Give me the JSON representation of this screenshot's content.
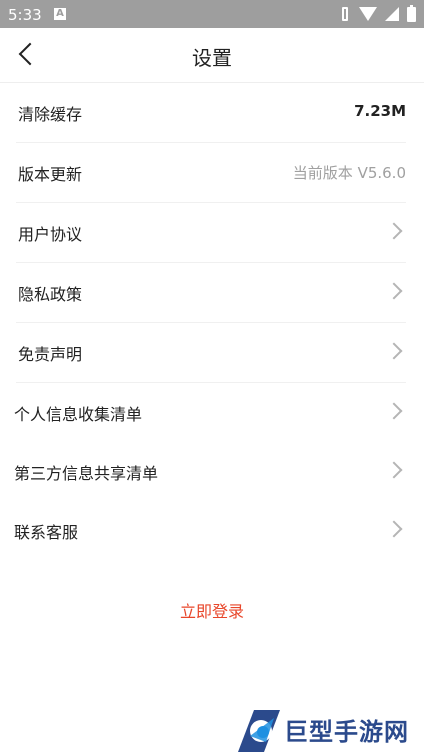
{
  "status": {
    "time": "5:33",
    "notif_letter": "A"
  },
  "header": {
    "title": "设置"
  },
  "rows": [
    {
      "label": "清除缓存",
      "value": "7.23M"
    },
    {
      "label": "版本更新",
      "value": "当前版本 V5.6.0"
    },
    {
      "label": "用户协议"
    },
    {
      "label": "隐私政策"
    },
    {
      "label": "免责声明"
    },
    {
      "label": "个人信息收集清单"
    },
    {
      "label": "第三方信息共享清单"
    },
    {
      "label": "联系客服"
    }
  ],
  "login_label": "立即登录",
  "watermark": {
    "text": "巨型手游网"
  },
  "colors": {
    "accent": "#e8462a",
    "status_bar": "#9e9e9e",
    "watermark": "#2b4a8c"
  }
}
